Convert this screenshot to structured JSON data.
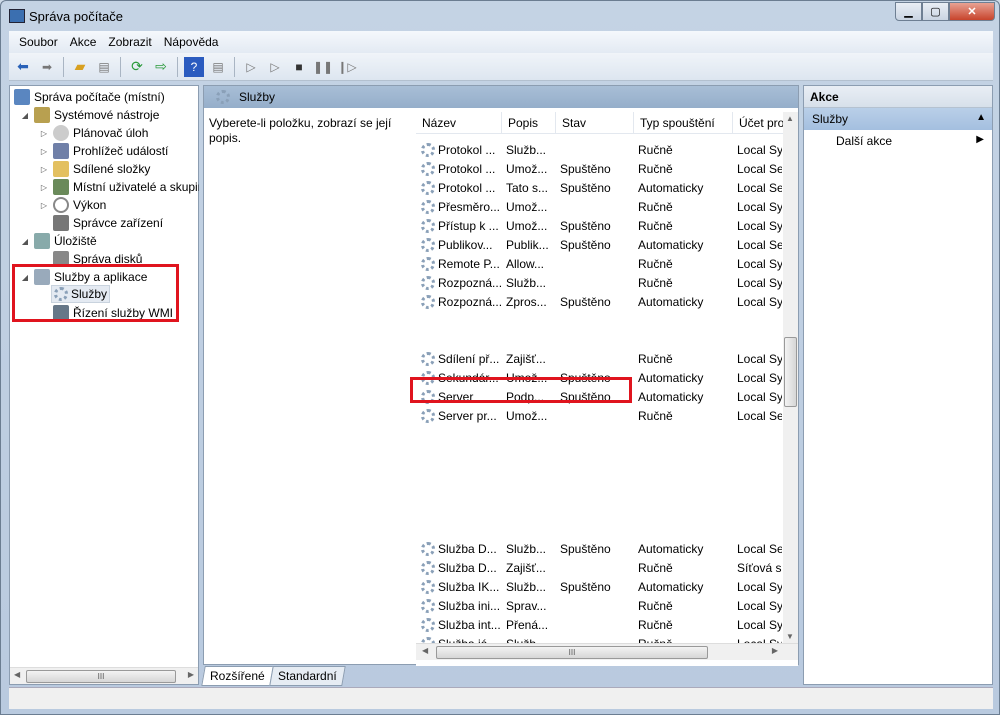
{
  "window": {
    "title": "Správa počítače",
    "minimize": "▁",
    "maximize": "▢",
    "close": "✕"
  },
  "menu": [
    "Soubor",
    "Akce",
    "Zobrazit",
    "Nápověda"
  ],
  "toolbar": {
    "icons": [
      "back-icon",
      "forward-icon",
      "up-icon",
      "show-hide-tree-icon",
      "refresh-icon",
      "export-icon",
      "help-icon",
      "show-hide-action-icon",
      "start-icon",
      "start-alt-icon",
      "stop-icon",
      "pause-icon",
      "resume-icon"
    ]
  },
  "tree": {
    "root": "Správa počítače (místní)",
    "system_tools": "Systémové nástroje",
    "task_scheduler": "Plánovač úloh",
    "event_viewer": "Prohlížeč událostí",
    "shared_folders": "Sdílené složky",
    "local_users": "Místní uživatelé a skupiny",
    "performance": "Výkon",
    "device_manager": "Správce zařízení",
    "storage": "Úložiště",
    "disk_management": "Správa disků",
    "services_apps": "Služby a aplikace",
    "services": "Služby",
    "wmi": "Řízení služby WMI"
  },
  "middle": {
    "header": "Služby",
    "description": "Vyberete-li položku, zobrazí se její popis."
  },
  "columns": [
    "Název",
    "Popis",
    "Stav",
    "Typ spouštění",
    "Účet pro"
  ],
  "rows_group1": [
    [
      "Protokol ...",
      "Služb...",
      "",
      "Ručně",
      "Local Sy"
    ],
    [
      "Protokol ...",
      "Umož...",
      "Spuštěno",
      "Ručně",
      "Local Se"
    ],
    [
      "Protokol ...",
      "Tato s...",
      "Spuštěno",
      "Automaticky",
      "Local Se"
    ],
    [
      "Přesměro...",
      "Umož...",
      "",
      "Ručně",
      "Local Sy"
    ],
    [
      "Přístup k ...",
      "Umož...",
      "Spuštěno",
      "Ručně",
      "Local Sy"
    ],
    [
      "Publikov...",
      "Publik...",
      "Spuštěno",
      "Automaticky",
      "Local Se"
    ],
    [
      "Remote P...",
      "Allow...",
      "",
      "Ručně",
      "Local Sy"
    ],
    [
      "Rozpozná...",
      "Služb...",
      "",
      "Ručně",
      "Local Sy"
    ],
    [
      "Rozpozná...",
      "Zpros...",
      "Spuštěno",
      "Automaticky",
      "Local Sy"
    ]
  ],
  "rows_group2": [
    [
      "Sdílení př...",
      "Zajišť...",
      "",
      "Ručně",
      "Local Sy"
    ],
    [
      "Sekundár...",
      "Umož...",
      "Spuštěno",
      "Automaticky",
      "Local Sy"
    ],
    [
      "Server",
      "Podp...",
      "Spuštěno",
      "Automaticky",
      "Local Sy"
    ],
    [
      "Server pr...",
      "Umož...",
      "",
      "Ručně",
      "Local Se"
    ]
  ],
  "rows_group3": [
    [
      "Služba D...",
      "Služb...",
      "Spuštěno",
      "Automaticky",
      "Local Se"
    ],
    [
      "Služba D...",
      "Zajišť...",
      "",
      "Ručně",
      "Síťová sl"
    ],
    [
      "Služba IK...",
      "Služb...",
      "Spuštěno",
      "Automaticky",
      "Local Sy"
    ],
    [
      "Služba ini...",
      "Sprav...",
      "",
      "Ručně",
      "Local Sy"
    ],
    [
      "Služba int...",
      "Přená...",
      "",
      "Ručně",
      "Local Sy"
    ],
    [
      "Služba já...",
      "Služb...",
      "",
      "Ručně",
      "Local Sy"
    ]
  ],
  "tabs": [
    "Rozšířené",
    "Standardní"
  ],
  "actions": {
    "header": "Akce",
    "section": "Služby",
    "more": "Další akce"
  }
}
